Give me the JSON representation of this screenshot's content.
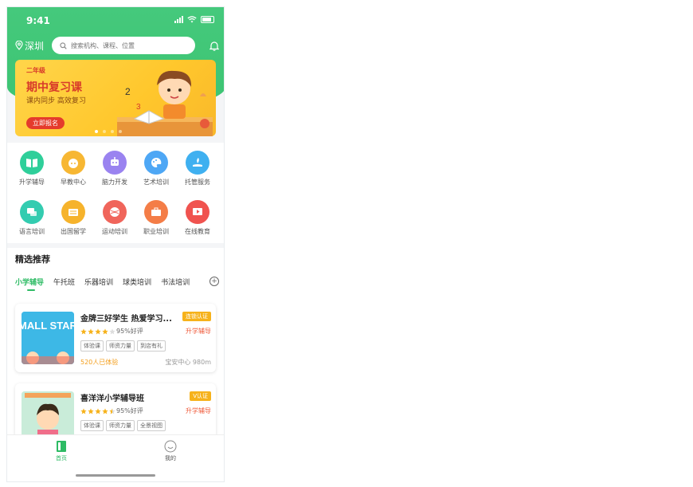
{
  "status_bar": {
    "time": "9:41"
  },
  "location": {
    "city": "深圳"
  },
  "search": {
    "placeholder": "搜索机构、课程、位置"
  },
  "banner": {
    "grade": "二年级",
    "title": "期中复习课",
    "subtitle": "课内同步 高效复习",
    "cta": "立即报名",
    "page_count": 4,
    "active_page": 1
  },
  "categories": [
    {
      "label": "升学辅导",
      "icon": "book-icon",
      "color": "#2fcf9a"
    },
    {
      "label": "早教中心",
      "icon": "baby-face-icon",
      "color": "#f7b733"
    },
    {
      "label": "脑力开发",
      "icon": "robot-icon",
      "color": "#9a83f0"
    },
    {
      "label": "艺术培训",
      "icon": "palette-icon",
      "color": "#4ea7f5"
    },
    {
      "label": "托管服务",
      "icon": "hand-leaf-icon",
      "color": "#3fb0f0"
    },
    {
      "label": "语言培训",
      "icon": "chat-icon",
      "color": "#33ccb0"
    },
    {
      "label": "出国留学",
      "icon": "passport-icon",
      "color": "#f6b32c"
    },
    {
      "label": "运动培训",
      "icon": "ball-icon",
      "color": "#f0655b"
    },
    {
      "label": "职业培训",
      "icon": "briefcase-icon",
      "color": "#f47d47"
    },
    {
      "label": "在线教育",
      "icon": "play-icon",
      "color": "#f0534f"
    }
  ],
  "recommend": {
    "title": "精选推荐",
    "tabs": [
      "小学辅导",
      "午托班",
      "乐器培训",
      "球类培训",
      "书法培训"
    ],
    "active_tab": 0,
    "items": [
      {
        "name": "金牌三好学生 热爱学习...",
        "badge": "连锁认证",
        "rating": 4,
        "good_rate": "95%好评",
        "category": "升学辅导",
        "tags": [
          "体验课",
          "师资力量",
          "到店有礼"
        ],
        "joined": "520人已体验",
        "location": "宝安中心 980m",
        "thumb_text": "SMALL STARS"
      },
      {
        "name": "喜洋洋小学辅导班",
        "badge": "V认证",
        "rating": 4.5,
        "good_rate": "95%好评",
        "category": "升学辅导",
        "tags": [
          "体验课",
          "师资力量",
          "全景视图"
        ],
        "joined": "",
        "location": "",
        "thumb_text": ""
      }
    ]
  },
  "tabbar": [
    {
      "label": "首页",
      "icon": "home-icon",
      "active": true
    },
    {
      "label": "我的",
      "icon": "profile-icon",
      "active": false
    }
  ],
  "colors": {
    "primary": "#2dbb64",
    "accent": "#f39d19",
    "danger": "#ef5a3a"
  }
}
